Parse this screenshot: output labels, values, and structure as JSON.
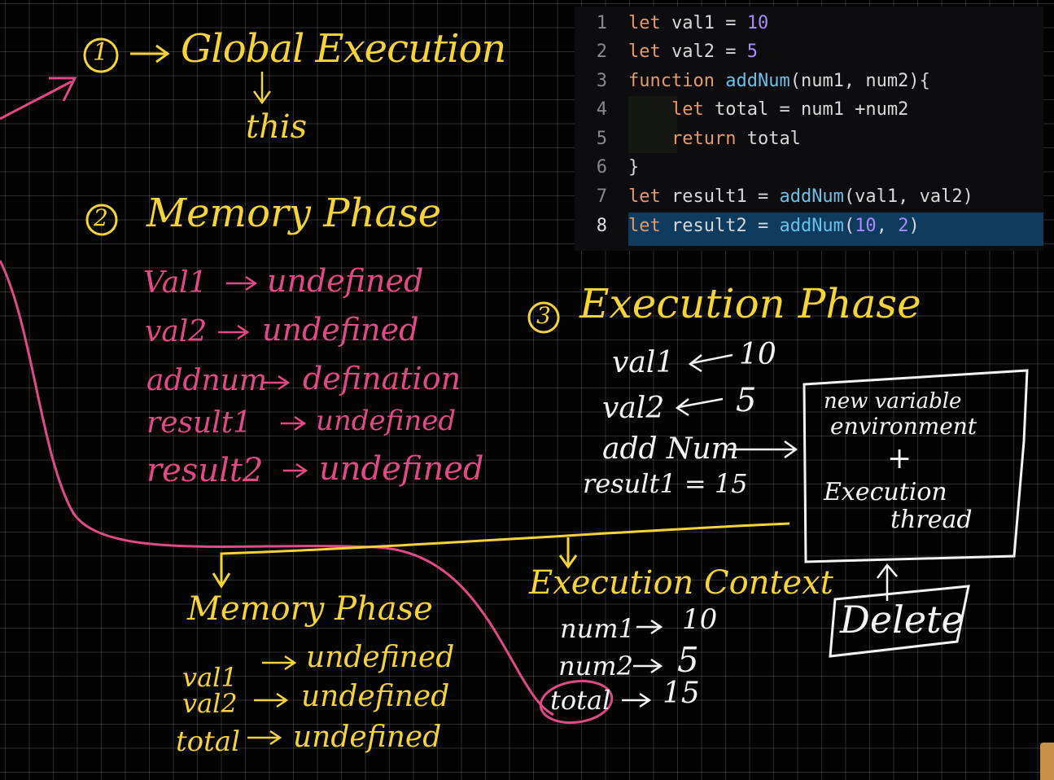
{
  "code": {
    "lines": [
      {
        "n": "1",
        "parts": [
          [
            "kw",
            "let "
          ],
          [
            "id",
            "val1 "
          ],
          [
            "op",
            "= "
          ],
          [
            "num",
            "10"
          ]
        ]
      },
      {
        "n": "2",
        "parts": [
          [
            "kw",
            "let "
          ],
          [
            "id",
            "val2 "
          ],
          [
            "op",
            "= "
          ],
          [
            "num",
            "5"
          ]
        ]
      },
      {
        "n": "3",
        "parts": [
          [
            "kw",
            "function "
          ],
          [
            "fn",
            "addNum"
          ],
          [
            "pn",
            "(num1, num2){"
          ]
        ]
      },
      {
        "n": "4",
        "parts": [
          [
            "id",
            "    "
          ],
          [
            "kw",
            "let "
          ],
          [
            "id",
            "total "
          ],
          [
            "op",
            "= "
          ],
          [
            "id",
            "num1 +num2"
          ]
        ]
      },
      {
        "n": "5",
        "parts": [
          [
            "id",
            "    "
          ],
          [
            "kw",
            "return "
          ],
          [
            "id",
            "total"
          ]
        ]
      },
      {
        "n": "6",
        "parts": [
          [
            "pn",
            "}"
          ]
        ]
      },
      {
        "n": "7",
        "parts": [
          [
            "kw",
            "let "
          ],
          [
            "id",
            "result1 "
          ],
          [
            "op",
            "= "
          ],
          [
            "fn",
            "addNum"
          ],
          [
            "pn",
            "(val1, val2)"
          ]
        ]
      },
      {
        "n": "8",
        "parts": [
          [
            "kw",
            "let "
          ],
          [
            "id",
            "result2 "
          ],
          [
            "op",
            "= "
          ],
          [
            "fn",
            "addNum"
          ],
          [
            "pn",
            "("
          ],
          [
            "num",
            "10"
          ],
          [
            "pn",
            ", "
          ],
          [
            "num",
            "2"
          ],
          [
            "pn",
            ")"
          ]
        ]
      }
    ],
    "highlighted_line": "8"
  },
  "notes": {
    "step1_marker": "1",
    "global_execution": "Global Execution",
    "this": "this",
    "step2_marker": "2",
    "memory_phase": "Memory Phase",
    "mem_val1": "Val1",
    "mem_val1_value": "undefined",
    "mem_val2": "val2",
    "mem_val2_value": "undefined",
    "mem_addnum": "addnum",
    "mem_addnum_value": "defination",
    "mem_result1": "result1",
    "mem_result1_value": "undefined",
    "mem_result2": "result2",
    "mem_result2_value": "undefined",
    "step3_marker": "3",
    "execution_phase": "Execution Phase",
    "exec_val1": "val1",
    "exec_val1_value": "10",
    "exec_val2": "val2",
    "exec_val2_value": "5",
    "exec_addnum": "add Num",
    "exec_result1": "result1 = 15",
    "box_line1": "new variable",
    "box_line2": "environment",
    "box_plus": "+",
    "box_line3": "Execution",
    "box_line4": "thread",
    "delete": "Delete",
    "sub_memory_phase": "Memory Phase",
    "sub_val1": "val1",
    "sub_val1_value": "undefined",
    "sub_val2": "val2",
    "sub_val2_value": "undefined",
    "sub_total": "total",
    "sub_total_value": "undefined",
    "exec_context": "Execution Context",
    "ctx_num1": "num1",
    "ctx_num1_value": "10",
    "ctx_num2": "num2",
    "ctx_num2_value": "5",
    "ctx_total": "total",
    "ctx_total_value": "15"
  },
  "colors": {
    "background": "#030303",
    "yellow_ink": "#f5d33a",
    "pink_ink": "#e14a86",
    "white_ink": "#f4f4f4",
    "line_highlight": "#0e3b5e"
  }
}
